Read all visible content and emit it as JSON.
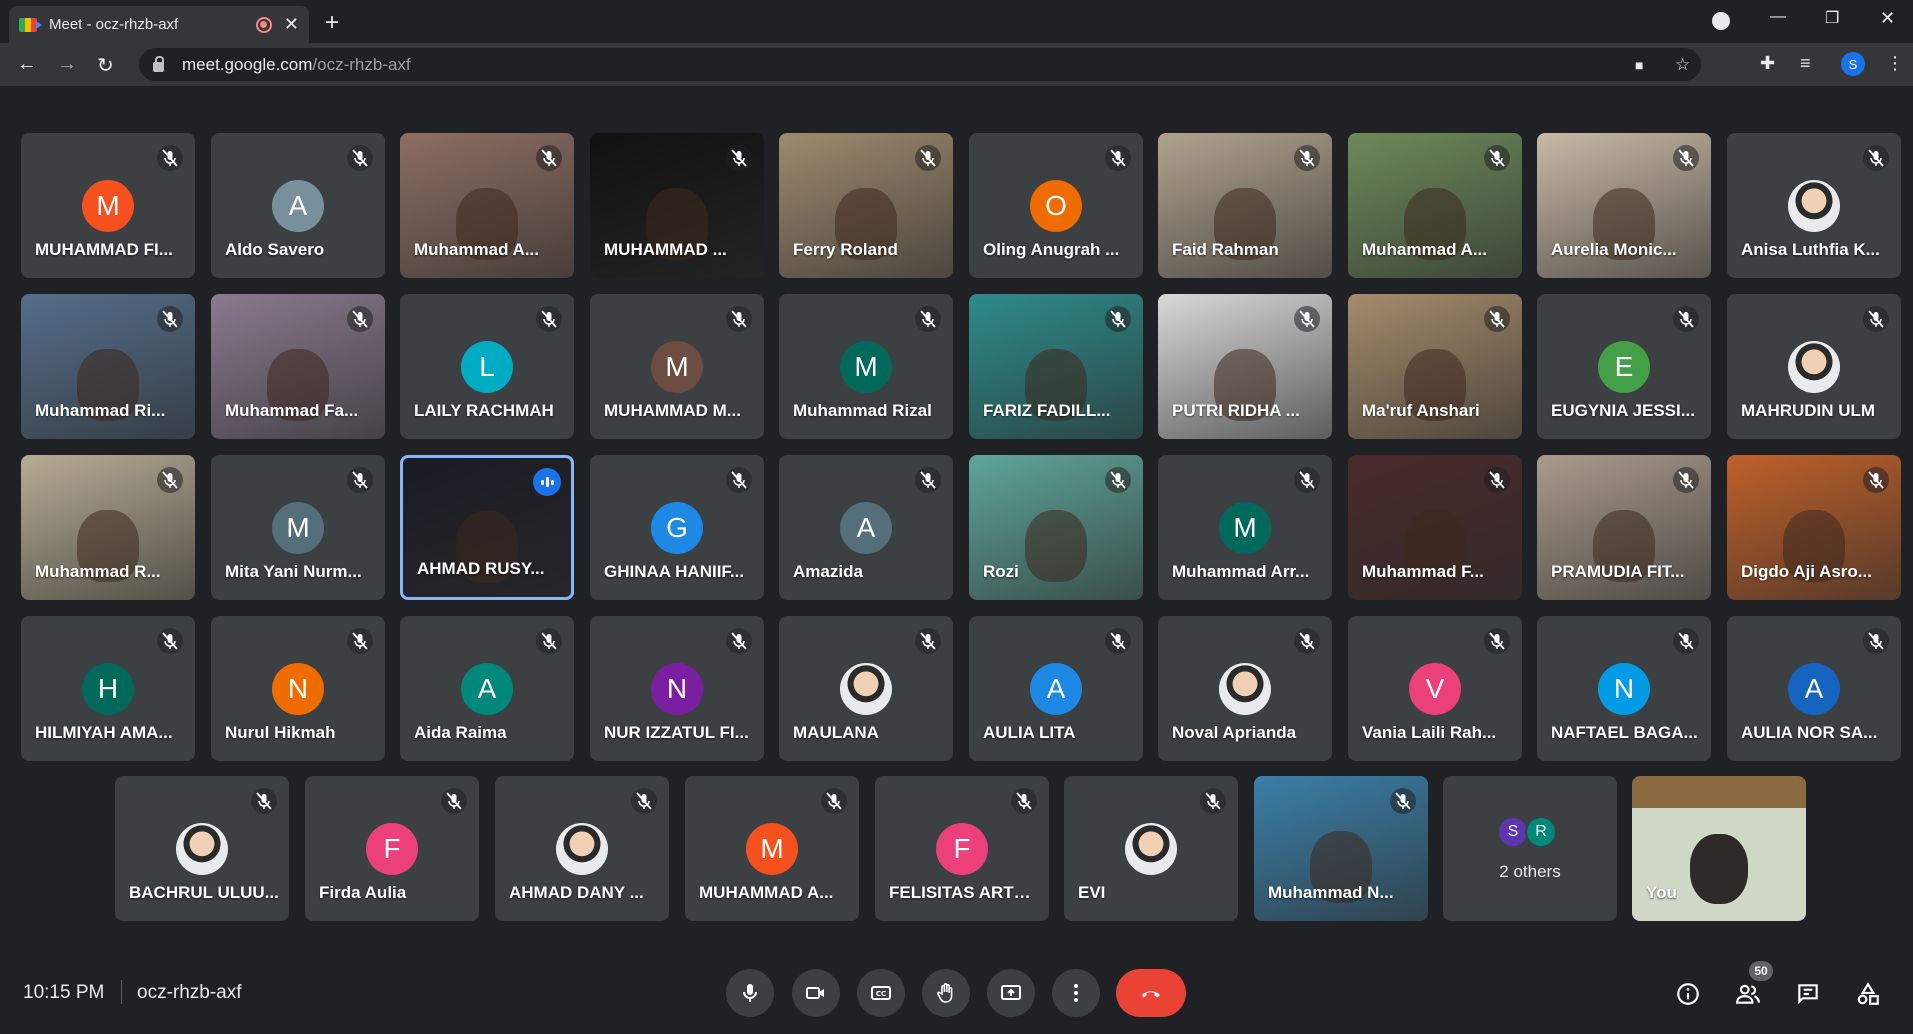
{
  "browser": {
    "tab_title": "Meet - ocz-rhzb-axf",
    "url_host": "meet.google.com",
    "url_path": "/ocz-rhzb-axf",
    "profile_initial": "S"
  },
  "participants": [
    {
      "name": "MUHAMMAD FI...",
      "initial": "M",
      "color": "#f4511e",
      "video": false
    },
    {
      "name": "Aldo Savero",
      "initial": "A",
      "color": "#78909c",
      "video": false
    },
    {
      "name": "Muhammad A...",
      "initial": "",
      "color": "#8d6e63",
      "video": true
    },
    {
      "name": "MUHAMMAD ...",
      "initial": "",
      "color": "#111111",
      "video": true
    },
    {
      "name": "Ferry Roland",
      "initial": "",
      "color": "#9e8a6e",
      "video": true
    },
    {
      "name": "Oling Anugrah ...",
      "initial": "O",
      "color": "#ef6c00",
      "video": false
    },
    {
      "name": "Faid Rahman",
      "initial": "",
      "color": "#b0a28e",
      "video": true
    },
    {
      "name": "Muhammad A...",
      "initial": "",
      "color": "#6d8a5a",
      "video": true
    },
    {
      "name": "Aurelia Monic...",
      "initial": "",
      "color": "#c9b9a6",
      "video": true
    },
    {
      "name": "Anisa Luthfia K...",
      "initial": "",
      "color": "#3c4043",
      "video": false,
      "photo": true
    },
    {
      "name": "Muhammad Ri...",
      "initial": "",
      "color": "#546e8a",
      "video": true
    },
    {
      "name": "Muhammad Fa...",
      "initial": "",
      "color": "#8a7a8e",
      "video": true
    },
    {
      "name": "LAILY RACHMAH",
      "initial": "L",
      "color": "#00acc1",
      "video": false
    },
    {
      "name": "MUHAMMAD M...",
      "initial": "M",
      "color": "#6d4c41",
      "video": false
    },
    {
      "name": "Muhammad Rizal",
      "initial": "M",
      "color": "#00695c",
      "video": false
    },
    {
      "name": "FARIZ FADILL...",
      "initial": "",
      "color": "#2e8b8b",
      "video": true
    },
    {
      "name": "PUTRI RIDHA ...",
      "initial": "",
      "color": "#d9d9d9",
      "video": true
    },
    {
      "name": "Ma'ruf Anshari",
      "initial": "",
      "color": "#a58b6a",
      "video": true
    },
    {
      "name": "EUGYNIA JESSI...",
      "initial": "E",
      "color": "#43a047",
      "video": false
    },
    {
      "name": "MAHRUDIN ULM",
      "initial": "",
      "color": "#3c4043",
      "video": false,
      "photo": true
    },
    {
      "name": "Muhammad R...",
      "initial": "",
      "color": "#b7ac94",
      "video": true
    },
    {
      "name": "Mita Yani Nurm...",
      "initial": "M",
      "color": "#546e7a",
      "video": false
    },
    {
      "name": "AHMAD RUSY...",
      "initial": "",
      "color": "#1b1b24",
      "video": true,
      "active": true
    },
    {
      "name": "GHINAA HANIIF...",
      "initial": "G",
      "color": "#1e88e5",
      "video": false
    },
    {
      "name": "Amazida",
      "initial": "A",
      "color": "#546e7a",
      "video": false
    },
    {
      "name": "Rozi",
      "initial": "",
      "color": "#5fa59a",
      "video": true
    },
    {
      "name": "Muhammad Arr...",
      "initial": "M",
      "color": "#00695c",
      "video": false
    },
    {
      "name": "Muhammad F...",
      "initial": "",
      "color": "#4a2a2a",
      "video": true
    },
    {
      "name": "PRAMUDIA FIT...",
      "initial": "",
      "color": "#a99a8c",
      "video": true
    },
    {
      "name": "Digdo Aji Asro...",
      "initial": "",
      "color": "#c0602a",
      "video": true
    },
    {
      "name": "HILMIYAH AMA...",
      "initial": "H",
      "color": "#00695c",
      "video": false
    },
    {
      "name": "Nurul Hikmah",
      "initial": "N",
      "color": "#ef6c00",
      "video": false
    },
    {
      "name": "Aida Raima",
      "initial": "A",
      "color": "#00897b",
      "video": false
    },
    {
      "name": "NUR IZZATUL FI...",
      "initial": "N",
      "color": "#7b1fa2",
      "video": false
    },
    {
      "name": "MAULANA",
      "initial": "",
      "color": "#3c4043",
      "video": false,
      "photo": true
    },
    {
      "name": "AULIA LITA",
      "initial": "A",
      "color": "#1e88e5",
      "video": false
    },
    {
      "name": "Noval Aprianda",
      "initial": "",
      "color": "#3c4043",
      "video": false,
      "photo": true
    },
    {
      "name": "Vania Laili Rah...",
      "initial": "V",
      "color": "#ec407a",
      "video": false
    },
    {
      "name": "NAFTAEL BAGA...",
      "initial": "N",
      "color": "#039be5",
      "video": false
    },
    {
      "name": "AULIA NOR SA...",
      "initial": "A",
      "color": "#1565c0",
      "video": false
    },
    {
      "name": "BACHRUL ULUU...",
      "initial": "",
      "color": "#3c4043",
      "video": false,
      "photo": true
    },
    {
      "name": "Firda Aulia",
      "initial": "F",
      "color": "#ec407a",
      "video": false
    },
    {
      "name": "AHMAD DANY ...",
      "initial": "",
      "color": "#3c4043",
      "video": false,
      "photo": true
    },
    {
      "name": "MUHAMMAD A...",
      "initial": "M",
      "color": "#f4511e",
      "video": false
    },
    {
      "name": "FELISITAS ARTE...",
      "initial": "F",
      "color": "#ec407a",
      "video": false
    },
    {
      "name": "EVI",
      "initial": "",
      "color": "#3c4043",
      "video": false,
      "photo": true
    },
    {
      "name": "Muhammad N...",
      "initial": "",
      "color": "#3b7fa8",
      "video": true
    }
  ],
  "others": {
    "label": "2 others",
    "initials": [
      "S",
      "R"
    ],
    "colors": [
      "#5e35b1",
      "#00897b"
    ]
  },
  "self": {
    "name": "You",
    "color": "#8fa88a"
  },
  "footer": {
    "time": "10:15 PM",
    "meeting_code": "ocz-rhzb-axf",
    "people_count": "50"
  }
}
